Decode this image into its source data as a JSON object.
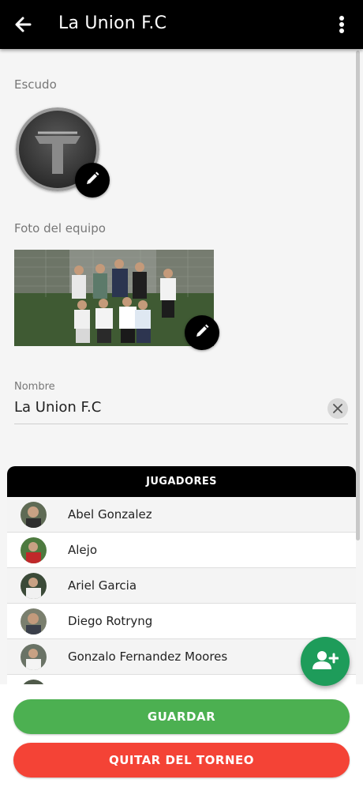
{
  "appbar": {
    "title": "La Union F.C"
  },
  "crest": {
    "label": "Escudo"
  },
  "team_photo": {
    "label": "Foto del equipo"
  },
  "name_field": {
    "label": "Nombre",
    "value": "La Union F.C"
  },
  "players": {
    "header": "JUGADORES",
    "items": [
      {
        "name": "Abel Gonzalez"
      },
      {
        "name": "Alejo"
      },
      {
        "name": "Ariel Garcia"
      },
      {
        "name": "Diego Rotryng"
      },
      {
        "name": "Gonzalo Fernandez Moores"
      },
      {
        "name": ""
      }
    ]
  },
  "actions": {
    "save": "GUARDAR",
    "remove": "QUITAR DEL TORNEO"
  },
  "colors": {
    "appbar": "#000000",
    "save": "#4cb051",
    "remove": "#f44336",
    "fab": "#1e9c5a"
  }
}
